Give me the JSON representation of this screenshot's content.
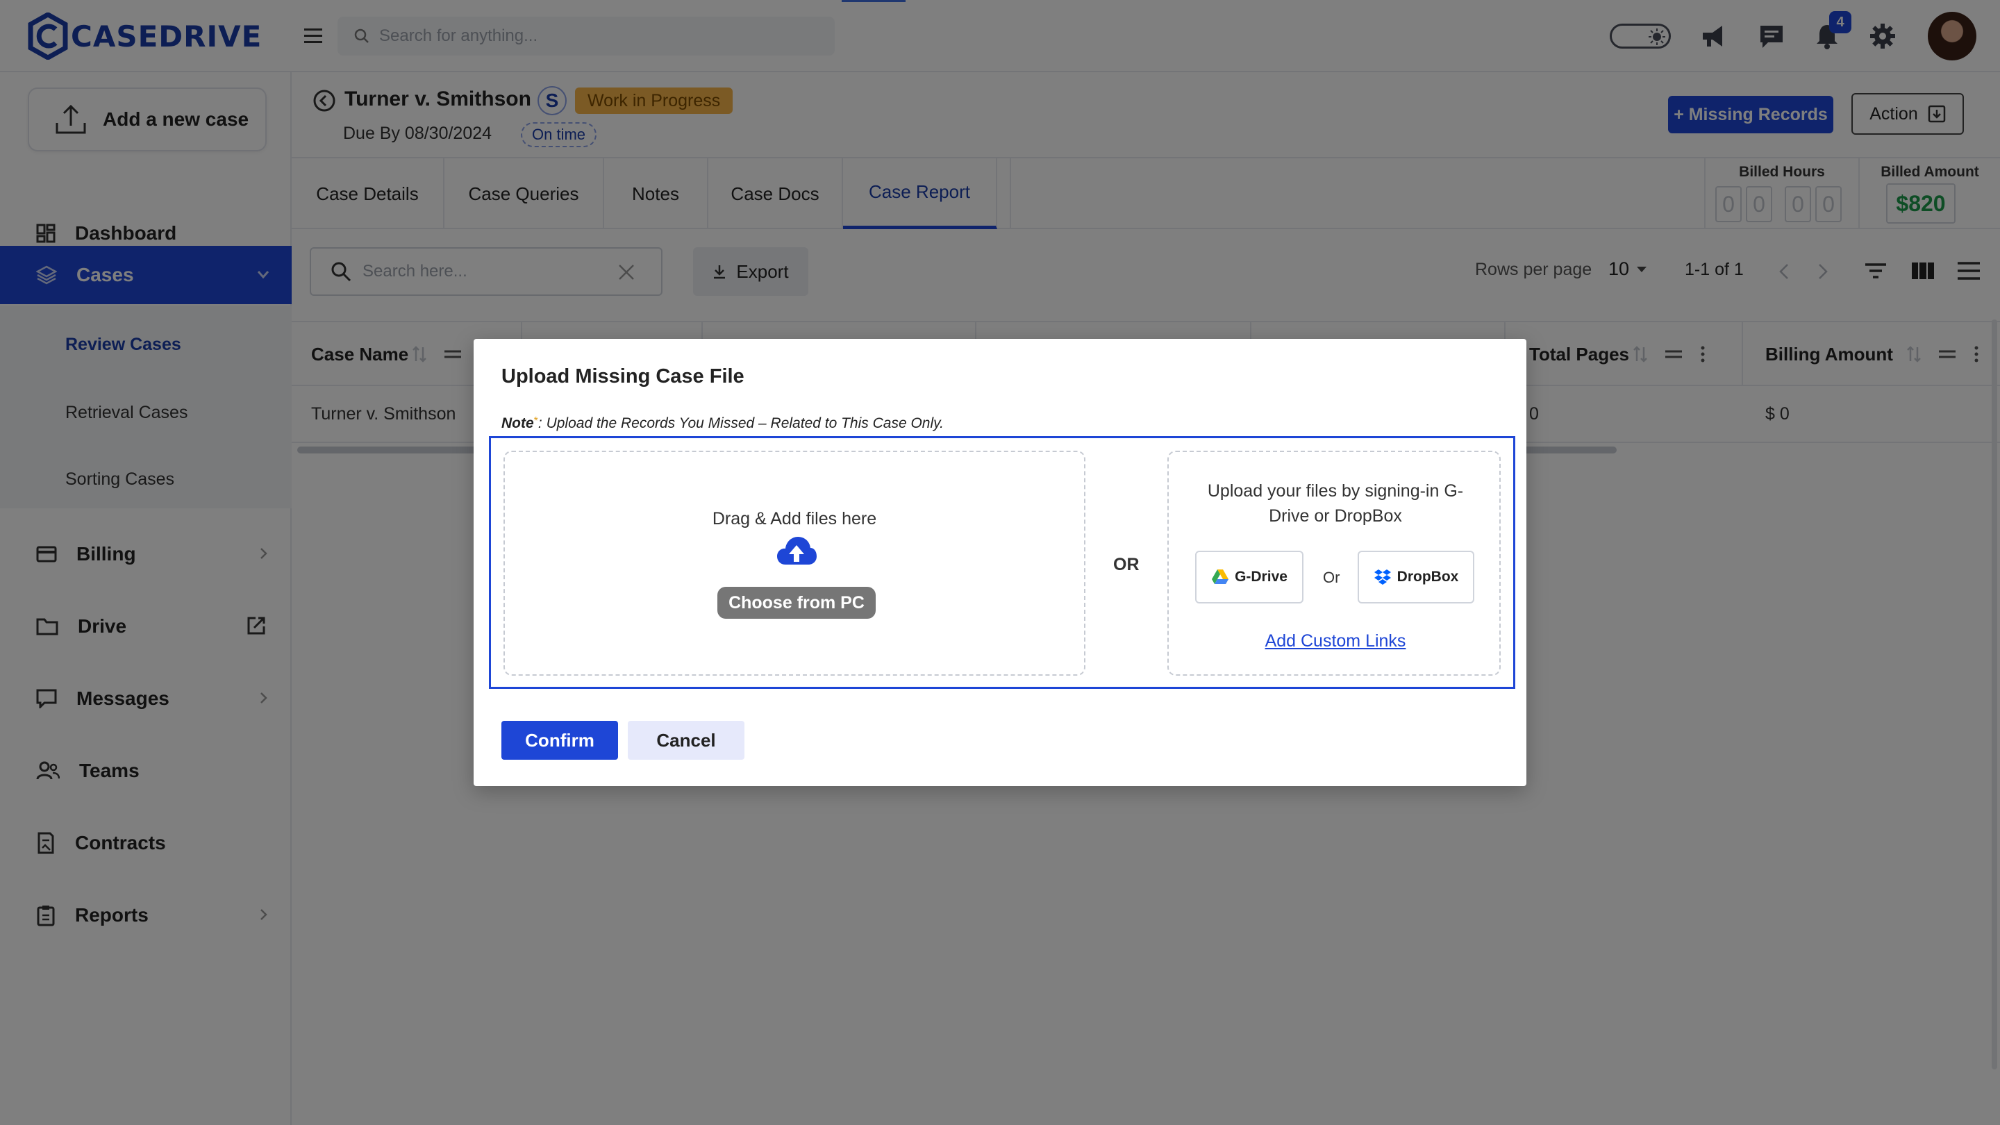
{
  "app": {
    "brand": "CASEDRIVE",
    "search_placeholder": "Search for anything...",
    "notification_count": "4",
    "accent_color": "#1e46d6"
  },
  "sidebar": {
    "add_case_label": "Add a new case",
    "items": [
      {
        "label": "Dashboard",
        "icon": "dashboard-icon"
      },
      {
        "label": "Cases",
        "icon": "layers-icon",
        "active": true
      },
      {
        "label": "Billing",
        "icon": "card-icon"
      },
      {
        "label": "Drive",
        "icon": "folder-icon"
      },
      {
        "label": "Messages",
        "icon": "chat-icon"
      },
      {
        "label": "Teams",
        "icon": "team-icon"
      },
      {
        "label": "Contracts",
        "icon": "contract-icon"
      },
      {
        "label": "Reports",
        "icon": "clipboard-icon"
      }
    ],
    "case_subitems": [
      {
        "label": "Review Cases",
        "active": true
      },
      {
        "label": "Retrieval Cases"
      },
      {
        "label": "Sorting Cases"
      }
    ]
  },
  "case": {
    "title": "Turner v. Smithson",
    "initial": "S",
    "status": "Work in Progress",
    "due": "Due By 08/30/2024",
    "timeliness": "On time",
    "missing_button": "+ Missing Records",
    "action_button": "Action"
  },
  "tabs": [
    {
      "label": "Case Details"
    },
    {
      "label": "Case Queries"
    },
    {
      "label": "Notes"
    },
    {
      "label": "Case Docs"
    },
    {
      "label": "Case Report",
      "active": true
    }
  ],
  "billing": {
    "hours_label": "Billed Hours",
    "hours_digits": [
      "0",
      "0",
      "0",
      "0"
    ],
    "amount_label": "Billed Amount",
    "amount": "$820"
  },
  "table": {
    "search_placeholder": "Search here...",
    "export_label": "Export",
    "rows_per_page_label": "Rows per page",
    "rows_per_page": "10",
    "pagination": "1-1 of 1",
    "columns": [
      "Case Name",
      "Total Pages",
      "Billing Amount"
    ],
    "rows": [
      {
        "case_name": "Turner v. Smithson",
        "total_pages": "0",
        "billing_amount": "$ 0"
      }
    ]
  },
  "modal": {
    "title": "Upload Missing Case File",
    "note_label": "Note",
    "note_text": ": Upload the Records You Missed – Related to This Case Only.",
    "drop_label": "Drag & Add files here",
    "choose_button": "Choose from PC",
    "or_label": "OR",
    "cloud_label": "Upload your files by signing-in G-Drive or DropBox",
    "gdrive_button": "G-Drive",
    "or_small": "Or",
    "dropbox_button": "DropBox",
    "custom_links": "Add Custom Links",
    "confirm_button": "Confirm",
    "cancel_button": "Cancel"
  }
}
